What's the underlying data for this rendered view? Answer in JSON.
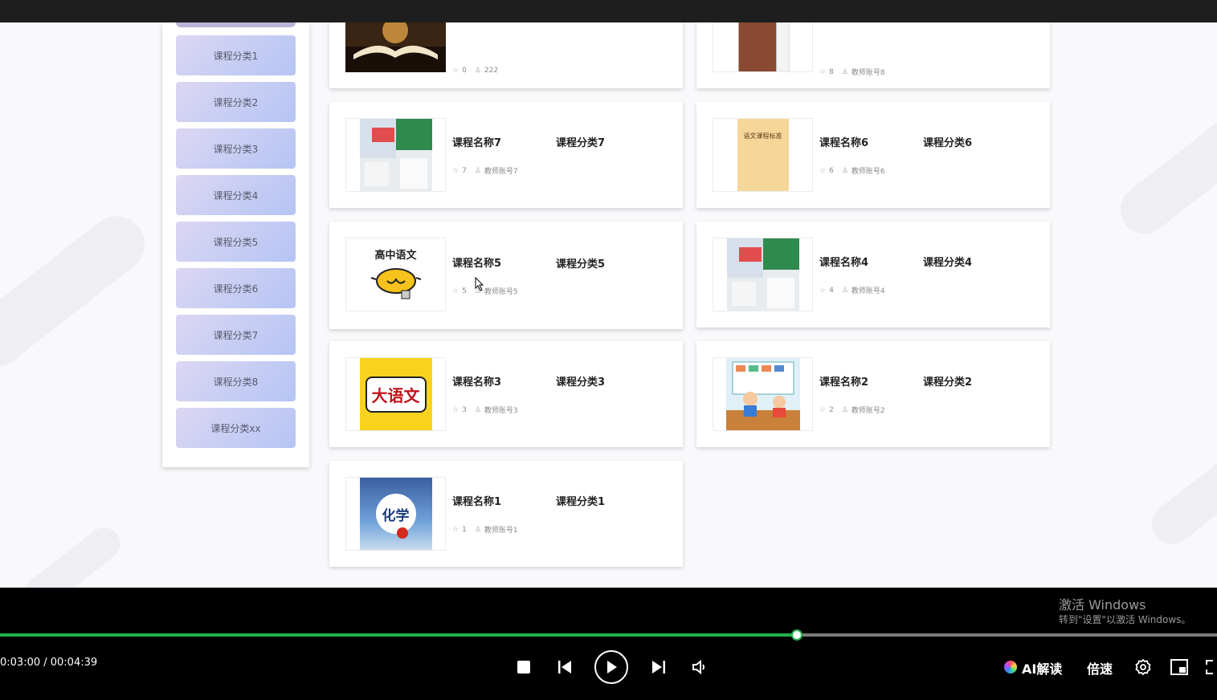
{
  "sidebar": {
    "items": [
      "课程分类1",
      "课程分类2",
      "课程分类3",
      "课程分类4",
      "课程分类5",
      "课程分类6",
      "课程分类7",
      "课程分类8",
      "课程分类xx"
    ]
  },
  "cards": [
    {
      "name": "",
      "category": "",
      "stars": "0",
      "author": "222",
      "thumb": "book-open"
    },
    {
      "name": "",
      "category": "",
      "stars": "8",
      "author": "教师账号8",
      "thumb": "brown-book"
    },
    {
      "name": "课程名称7",
      "category": "课程分类7",
      "stars": "7",
      "author": "教师账号7",
      "thumb": "textbook-green"
    },
    {
      "name": "课程名称6",
      "category": "课程分类6",
      "stars": "6",
      "author": "教师账号6",
      "thumb": "yellow-standard",
      "thumb_text": "语文课程标准"
    },
    {
      "name": "课程名称5",
      "category": "课程分类5",
      "stars": "5",
      "author": "教师账号5",
      "thumb": "lightbulb",
      "thumb_text": "高中语文"
    },
    {
      "name": "课程名称4",
      "category": "课程分类4",
      "stars": "4",
      "author": "教师账号4",
      "thumb": "textbook-green"
    },
    {
      "name": "课程名称3",
      "category": "课程分类3",
      "stars": "3",
      "author": "教师账号3",
      "thumb": "yellow-chinese",
      "thumb_text": "大语文"
    },
    {
      "name": "课程名称2",
      "category": "课程分类2",
      "stars": "2",
      "author": "教师账号2",
      "thumb": "kids-table"
    },
    {
      "name": "课程名称1",
      "category": "课程分类1",
      "stars": "1",
      "author": "教师账号1",
      "thumb": "chemistry",
      "thumb_text": "化学"
    }
  ],
  "player": {
    "time": "0:03:00 / 00:04:39",
    "progress": 0.655,
    "ai_label": "AI解读",
    "speed_label": "倍速",
    "watermark_title": "激活 Windows",
    "watermark_sub": "转到\"设置\"以激活 Windows。"
  },
  "colors": {
    "accent": "#23b14d",
    "sidebar_gradient_start": "#ddd6f3",
    "sidebar_gradient_end": "#b5c4f4"
  }
}
